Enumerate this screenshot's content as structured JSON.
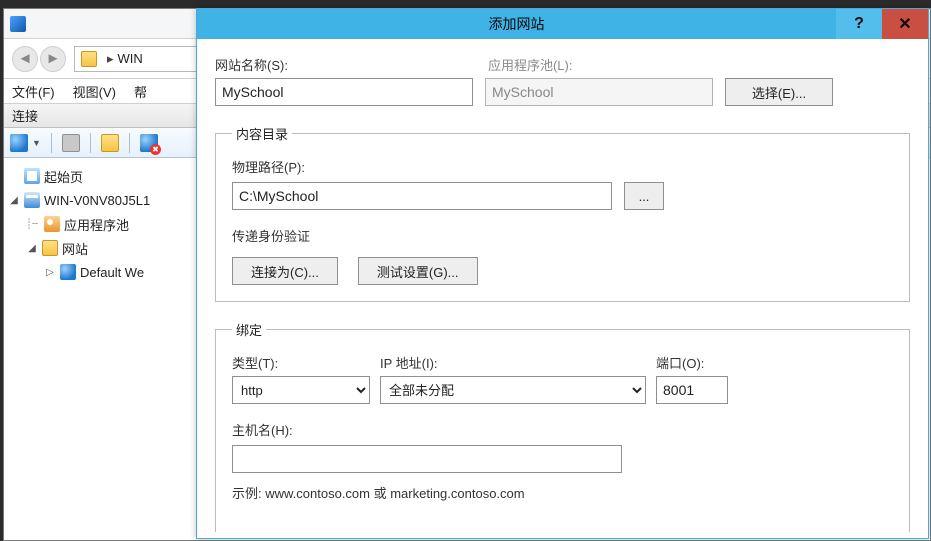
{
  "iis": {
    "breadcrumb_root": "WIN",
    "menu": {
      "file": "文件(F)",
      "view": "视图(V)",
      "help": "帮"
    },
    "panel_title": "连接",
    "tree": {
      "start": "起始页",
      "server": "WIN-V0NV80J5L1",
      "apppools": "应用程序池",
      "sites": "网站",
      "default": "Default We"
    }
  },
  "dialog": {
    "title": "添加网站",
    "site_name_label": "网站名称(S):",
    "site_name": "MySchool",
    "apppool_label": "应用程序池(L):",
    "apppool": "MySchool",
    "select_btn": "选择(E)...",
    "content_group": "内容目录",
    "phys_path_label": "物理路径(P):",
    "phys_path": "C:\\MySchool",
    "browse_btn": "...",
    "passthru_label": "传递身份验证",
    "connect_as_btn": "连接为(C)...",
    "test_btn": "测试设置(G)...",
    "binding_group": "绑定",
    "type_label": "类型(T):",
    "type_value": "http",
    "ip_label": "IP 地址(I):",
    "ip_value": "全部未分配",
    "port_label": "端口(O):",
    "port_value": "8001",
    "host_label": "主机名(H):",
    "host_value": "",
    "example": "示例: www.contoso.com 或 marketing.contoso.com"
  }
}
